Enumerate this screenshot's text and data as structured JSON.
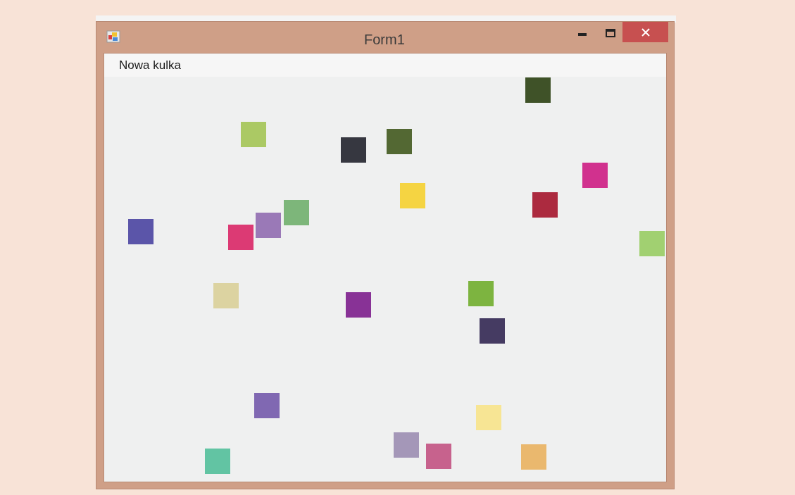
{
  "window": {
    "title": "Form1"
  },
  "menu": [
    {
      "label": "Nowa kulka"
    }
  ],
  "squares": [
    {
      "color": "#3f5228"
    },
    {
      "color": "#abc964"
    },
    {
      "color": "#363740"
    },
    {
      "color": "#536833"
    },
    {
      "color": "#d1318e"
    },
    {
      "color": "#f5d442"
    },
    {
      "color": "#ac2a3f"
    },
    {
      "color": "#7db67a"
    },
    {
      "color": "#9a79b7"
    },
    {
      "color": "#5b55a9"
    },
    {
      "color": "#dc3a74"
    },
    {
      "color": "#a1d071"
    },
    {
      "color": "#dcd3a1"
    },
    {
      "color": "#883296"
    },
    {
      "color": "#7db440"
    },
    {
      "color": "#453b62"
    },
    {
      "color": "#8068b2"
    },
    {
      "color": "#f7e594"
    },
    {
      "color": "#a497b8"
    },
    {
      "color": "#c7628d"
    },
    {
      "color": "#eab86e"
    },
    {
      "color": "#62c4a3"
    }
  ]
}
